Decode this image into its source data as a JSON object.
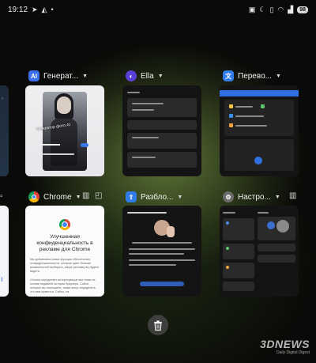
{
  "status_bar": {
    "time": "19:12",
    "battery": "98"
  },
  "recents": {
    "top_row": [
      {
        "app": "Генерат...",
        "icon": "ai-generator-icon",
        "accent": "#3b6ee8"
      },
      {
        "app": "Ella",
        "icon": "ella-icon",
        "accent": "#5a3fd6"
      },
      {
        "app": "Перево...",
        "icon": "translator-icon",
        "accent": "#2f7be8"
      }
    ],
    "bottom_row": [
      {
        "app": "Chrome",
        "icon": "chrome-icon"
      },
      {
        "app": "Разбло...",
        "icon": "unlock-icon",
        "accent": "#2f7be8"
      },
      {
        "app": "Настро...",
        "icon": "settings-icon",
        "accent": "#6b6b6b"
      }
    ],
    "generator_preview": {
      "title": "Генератор фото AI"
    },
    "chrome_preview": {
      "title": "Улучшенная конфиденциальность в рекламе для Chrome",
      "paragraph_1": "Мы добавляем новые функции обеспечения конфиденциальности, которые дают больше возможностей выбирать, какую рекламу вы будете видеть.",
      "paragraph_2": "Chrome определяет интересующие вас темы на основе недавней истории браузера. Сайты, которые вы посещаете, также могут определять, что вам нравится. Сайты, на"
    }
  },
  "clear_all": "trash-icon",
  "watermark": {
    "brand": "3DNEWS",
    "tagline": "Daily Digital Digest"
  }
}
